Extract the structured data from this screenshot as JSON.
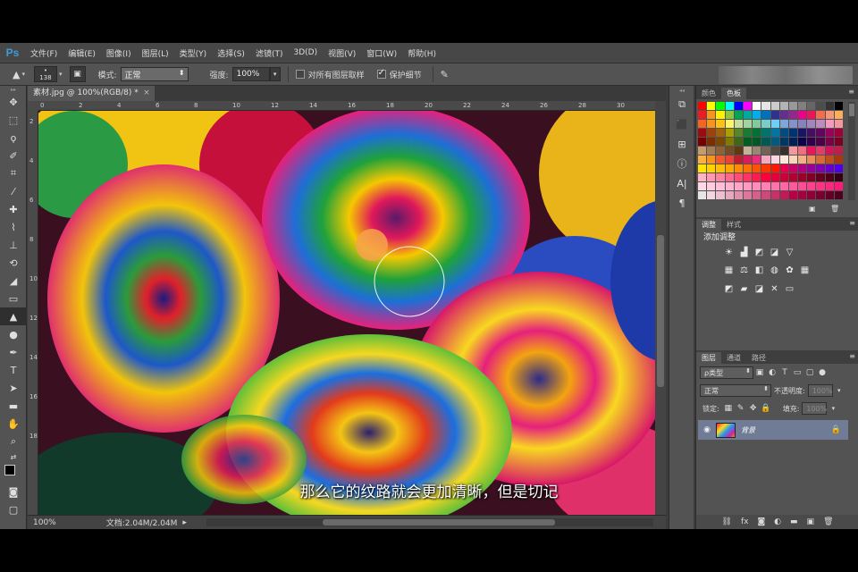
{
  "app": {
    "logo": "Ps",
    "menu": [
      "文件(F)",
      "编辑(E)",
      "图像(I)",
      "图层(L)",
      "类型(Y)",
      "选择(S)",
      "滤镜(T)",
      "3D(D)",
      "视图(V)",
      "窗口(W)",
      "帮助(H)"
    ]
  },
  "options": {
    "brush_size": "138",
    "mode_label": "模式:",
    "mode_value": "正常",
    "strength_label": "强度:",
    "strength_value": "100%",
    "sample_all_label": "对所有图层取样",
    "sample_all_checked": false,
    "protect_detail_label": "保护细节",
    "protect_detail_checked": true
  },
  "document": {
    "tab_title": "素材.jpg @ 100%(RGB/8) *",
    "tab_close": "×",
    "status_zoom": "100%",
    "status_doc": "文档:2.04M/2.04M",
    "ruler_h": [
      "0",
      "2",
      "4",
      "6",
      "8",
      "10",
      "12",
      "14",
      "16",
      "18",
      "20",
      "22",
      "24",
      "26",
      "28",
      "30",
      "32"
    ],
    "ruler_v": [
      "2",
      "4",
      "6",
      "8",
      "10",
      "12",
      "14",
      "16",
      "18"
    ]
  },
  "subtitle": "那么它的纹路就会更加清晰，但是切记",
  "tools": [
    "move-icon",
    "marquee-icon",
    "lasso-icon",
    "quick-select-icon",
    "crop-icon",
    "eyedropper-icon",
    "healing-icon",
    "brush-icon",
    "stamp-icon",
    "history-brush-icon",
    "eraser-icon",
    "gradient-icon",
    "sharpen-icon",
    "dodge-icon",
    "pen-icon",
    "type-icon",
    "path-select-icon",
    "shape-icon",
    "hand-icon",
    "zoom-icon"
  ],
  "panels": {
    "swatch_tabs": [
      "颜色",
      "色板"
    ],
    "adjust_tabs": [
      "调整",
      "样式"
    ],
    "adjust_title": "添加调整",
    "layer_tabs": [
      "图层",
      "通道",
      "路径"
    ],
    "layer_filter": "ρ类型",
    "blend_mode": "正常",
    "opacity_label": "不透明度:",
    "opacity_value": "100%",
    "lock_label": "锁定:",
    "fill_label": "填充:",
    "fill_value": "100%",
    "layer_name": "背景"
  }
}
